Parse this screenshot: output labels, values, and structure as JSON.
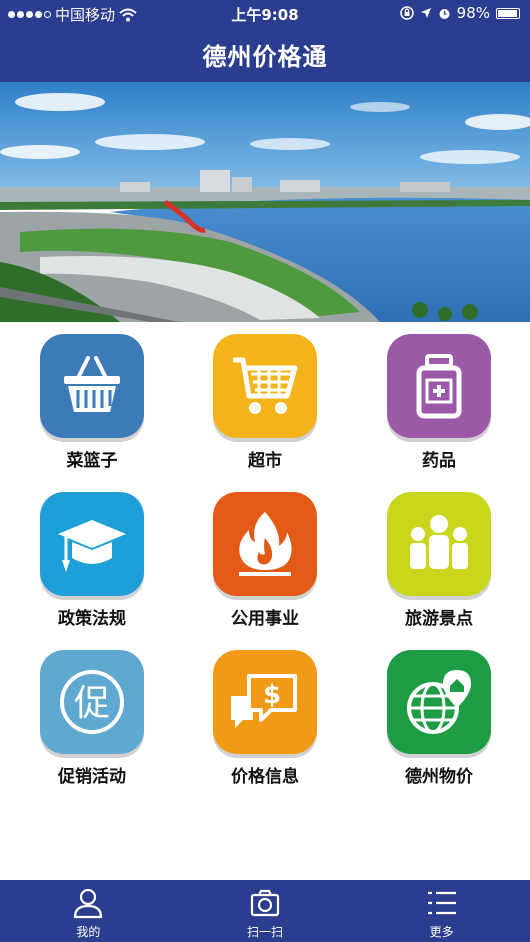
{
  "status_bar": {
    "carrier": "中国移动",
    "time": "上午9:08",
    "battery": "98%"
  },
  "nav": {
    "title": "德州价格通"
  },
  "grid": {
    "items": [
      {
        "label": "菜篮子",
        "icon": "basket-icon",
        "color": "#3d7ab8"
      },
      {
        "label": "超市",
        "icon": "shopping-cart-icon",
        "color": "#f2b41a"
      },
      {
        "label": "药品",
        "icon": "medicine-bottle-icon",
        "color": "#9b5aa8"
      },
      {
        "label": "政策法规",
        "icon": "graduation-cap-icon",
        "color": "#1e9fd8"
      },
      {
        "label": "公用事业",
        "icon": "flame-icon",
        "color": "#e25a16"
      },
      {
        "label": "旅游景点",
        "icon": "people-icon",
        "color": "#c9d61b"
      },
      {
        "label": "促销活动",
        "icon": "promotion-icon",
        "color": "#5fa8cf"
      },
      {
        "label": "价格信息",
        "icon": "price-chat-icon",
        "color": "#f19a16"
      },
      {
        "label": "德州物价",
        "icon": "globe-location-icon",
        "color": "#1e9b45"
      }
    ]
  },
  "tab_bar": {
    "items": [
      {
        "label": "我的",
        "icon": "user-icon"
      },
      {
        "label": "扫一扫",
        "icon": "camera-icon"
      },
      {
        "label": "更多",
        "icon": "menu-list-icon"
      }
    ]
  }
}
